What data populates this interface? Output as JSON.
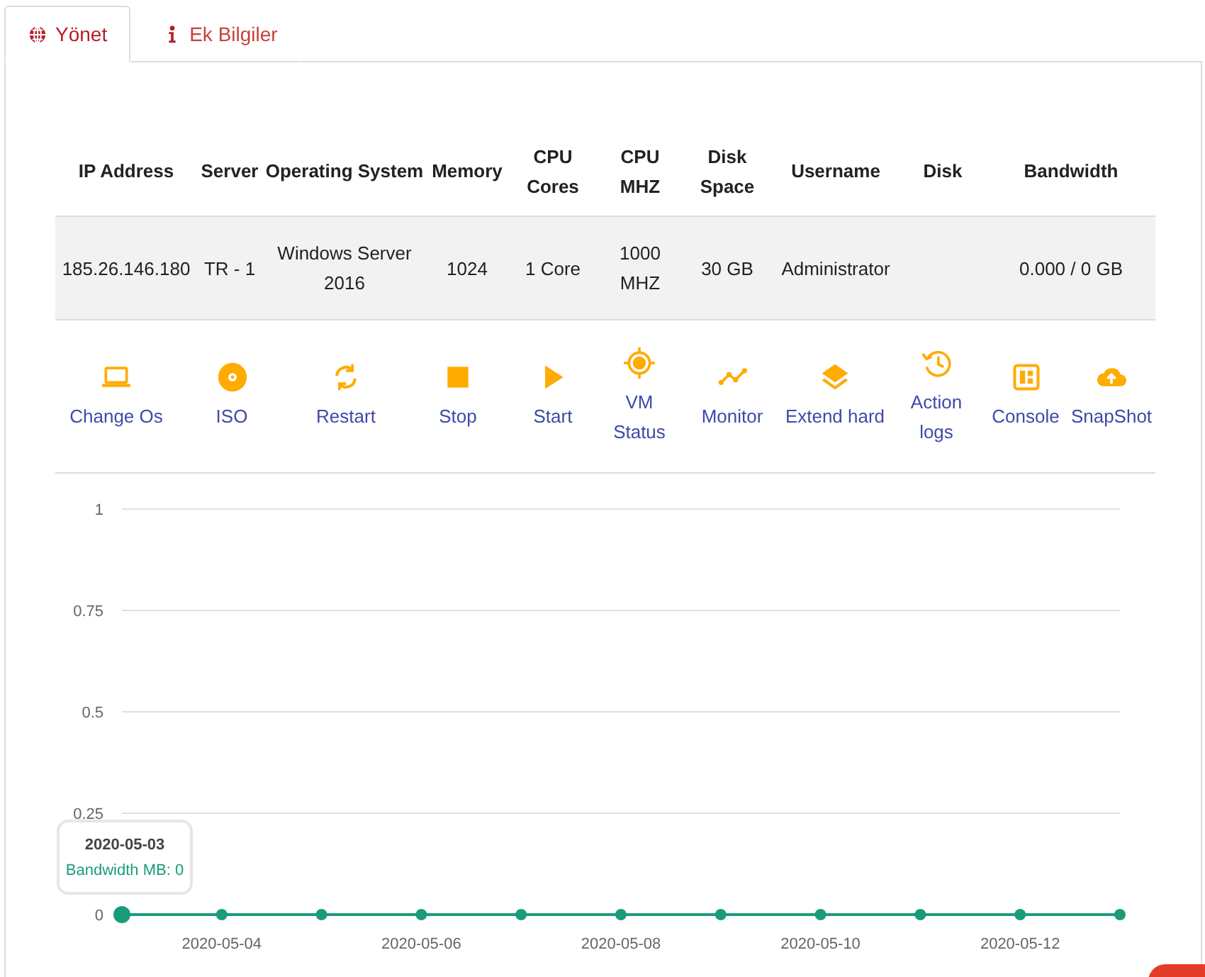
{
  "tabs": [
    {
      "label": "Yönet",
      "selected": true
    },
    {
      "label": "Ek Bilgiler",
      "selected": false
    }
  ],
  "table": {
    "columns": [
      "IP Address",
      "Server",
      "Operating System",
      "Memory",
      "CPU Cores",
      "CPU MHZ",
      "Disk Space",
      "Username",
      "Disk",
      "Bandwidth"
    ],
    "rows": [
      [
        "185.26.146.180",
        "TR - 1",
        "Windows Server 2016",
        "1024",
        "1 Core",
        "1000 MHZ",
        "30 GB",
        "Administrator",
        "",
        "0.000 / 0 GB"
      ]
    ]
  },
  "actions": [
    "Change Os",
    "ISO",
    "Restart",
    "Stop",
    "Start",
    "VM Status",
    "Monitor",
    "Extend hard",
    "Action logs",
    "Console",
    "SnapShot"
  ],
  "chart": {
    "chart_data": {
      "type": "line",
      "grid": true,
      "categories": [
        null,
        "2020-05-04",
        null,
        "2020-05-06",
        null,
        "2020-05-08",
        null,
        "2020-05-10",
        null,
        "2020-05-12",
        null
      ],
      "series": [
        {
          "color": "#1a9c7a",
          "marker": true,
          "values": [
            0,
            0,
            0,
            0,
            0,
            0,
            0,
            0,
            0,
            0,
            0
          ]
        }
      ],
      "ylim": [
        0,
        1
      ],
      "yticks": [
        0,
        {
          "value": 0.25,
          "label": "0.25"
        },
        {
          "value": 0.5,
          "label": "0.5"
        },
        {
          "value": 0.75,
          "label": "0.75"
        },
        1
      ]
    },
    "tooltip": {
      "title": "2020-05-03",
      "text": "Bandwidth MB: 0"
    }
  }
}
